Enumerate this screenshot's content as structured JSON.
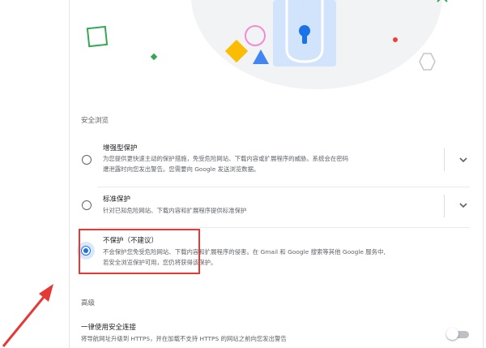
{
  "colors": {
    "accent": "#1a73e8",
    "annotation": "#e53935",
    "muted_text": "#5f6368"
  },
  "safe_browsing": {
    "section_label": "安全浏览",
    "options": [
      {
        "title": "增强型保护",
        "desc_line1": "为您提供更快速主动的保护措施，免受危险网站、下载内容或扩展程序的威胁。系统会在密码",
        "desc_line2": "遭泄露时向您发出警告。您需要向 Google 发送浏览数据。",
        "selected": false
      },
      {
        "title": "标准保护",
        "desc_line1": "针对已知危险网站、下载内容和扩展程序提供标准保护",
        "selected": false
      },
      {
        "title": "不保护（不建议）",
        "desc_line1": "不会保护您免受危险网站、下载内容和扩展程序的侵害。在 Gmail 和 Google 搜索等其他 Google 服务中,",
        "desc_line2": "若安全浏览保护可用，您仍将获得该保护。",
        "selected": true
      }
    ]
  },
  "advanced": {
    "section_label": "高级",
    "https_title": "一律使用安全连接",
    "https_desc": "将导航网址升级到 HTTPS，并在加载不支持 HTTPS 的网站之前向您发出警告",
    "https_enabled": false
  },
  "icons": {
    "hero": "lock-illustration",
    "expand": "chevron-down-icon",
    "annotation": "red-arrow"
  }
}
